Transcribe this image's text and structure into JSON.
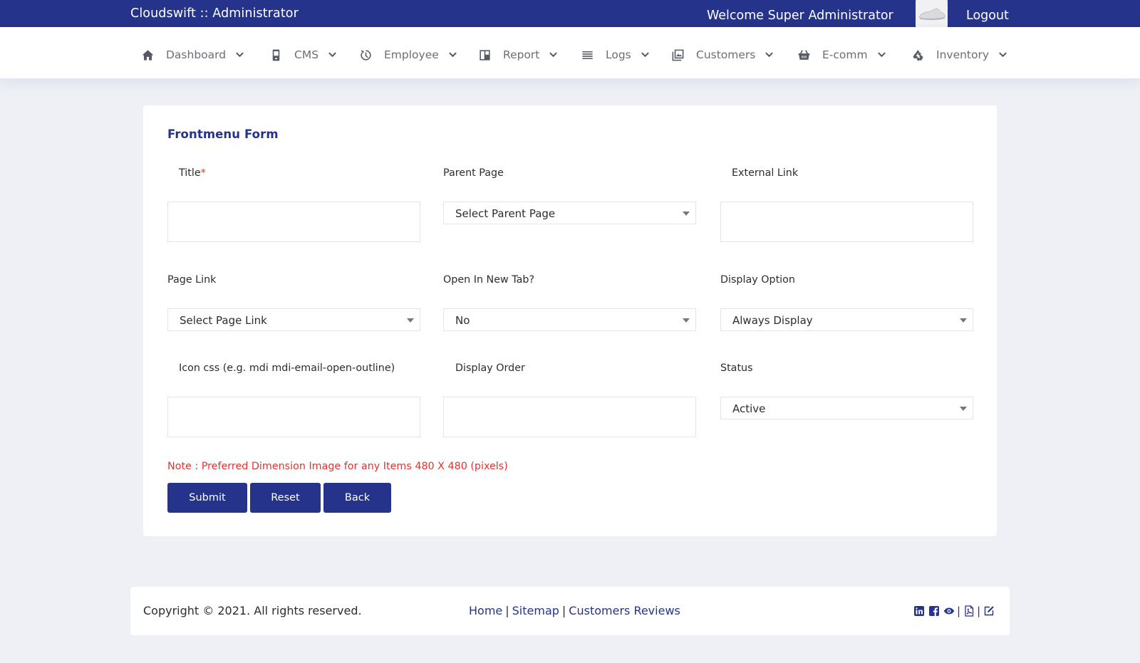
{
  "header": {
    "brand": "Cloudswift :: Administrator",
    "welcome": "Welcome Super Administrator",
    "logout": "Logout"
  },
  "nav": {
    "items": [
      {
        "label": "Dashboard",
        "icon": "home-icon"
      },
      {
        "label": "CMS",
        "icon": "phone-icon"
      },
      {
        "label": "Employee",
        "icon": "clock-icon"
      },
      {
        "label": "Report",
        "icon": "layout-icon"
      },
      {
        "label": "Logs",
        "icon": "list-icon"
      },
      {
        "label": "Customers",
        "icon": "image-icon"
      },
      {
        "label": "E-comm",
        "icon": "basket-icon"
      },
      {
        "label": "Inventory",
        "icon": "recycle-icon"
      }
    ]
  },
  "form": {
    "title": "Frontmenu Form",
    "fields": {
      "title_label": "Title",
      "title_required": "*",
      "title_value": "",
      "parent_page_label": "Parent Page",
      "parent_page_value": "Select Parent Page",
      "external_link_label": "External Link",
      "external_link_value": "",
      "page_link_label": "Page Link",
      "page_link_value": "Select Page Link",
      "open_new_tab_label": "Open In New Tab?",
      "open_new_tab_value": "No",
      "display_option_label": "Display Option",
      "display_option_value": "Always Display",
      "icon_css_label": "Icon css (e.g. mdi mdi-email-open-outline)",
      "icon_css_value": "",
      "display_order_label": "Display Order",
      "display_order_value": "",
      "status_label": "Status",
      "status_value": "Active"
    },
    "note": "Note : Preferred Dimension Image for any Items 480 X 480 (pixels)",
    "buttons": {
      "submit": "Submit",
      "reset": "Reset",
      "back": "Back"
    }
  },
  "footer": {
    "copyright": "Copyright © 2021. All rights reserved.",
    "links": [
      "Home",
      "Sitemap",
      "Customers Reviews"
    ],
    "link_separator": "|",
    "icons": [
      "linkedin-icon",
      "facebook-icon",
      "eye-icon",
      "pdf-icon",
      "edit-icon"
    ]
  },
  "colors": {
    "primary": "#25348a",
    "background": "#eef0f5",
    "danger": "#e5312f"
  }
}
